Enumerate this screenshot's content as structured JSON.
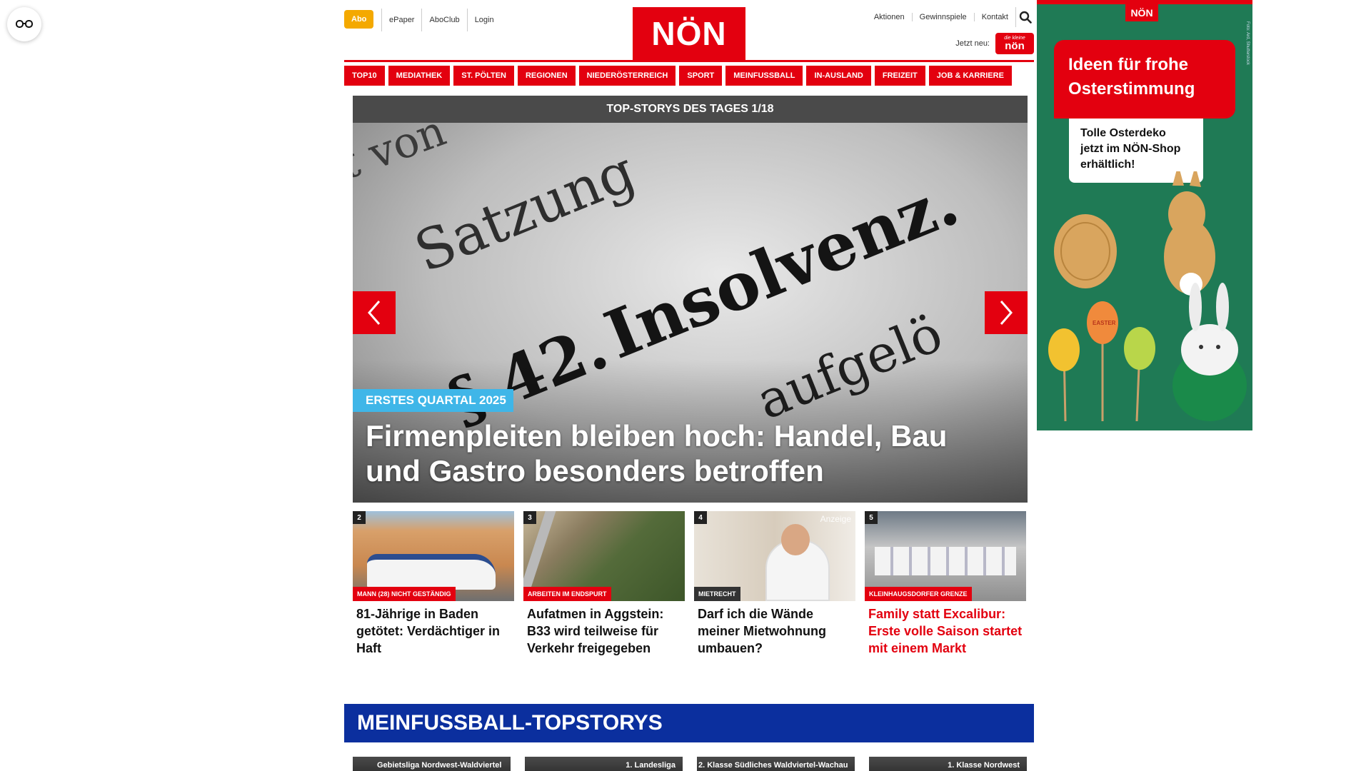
{
  "header": {
    "abo_label": "Abo",
    "left_links": [
      "ePaper",
      "AboClub",
      "Login"
    ],
    "logo_text": "NÖN",
    "right_links": [
      "Aktionen",
      "Gewinnspiele",
      "Kontakt"
    ],
    "jetzt_neu_label": "Jetzt neu:",
    "badge_small": "die kleine",
    "badge_text": "nön"
  },
  "nav": {
    "items": [
      "TOP10",
      "MEDIATHEK",
      "ST. PÖLTEN",
      "REGIONEN",
      "NIEDERÖSTERREICH",
      "SPORT",
      "MEINFUSSBALL",
      "IN-AUSLAND",
      "FREIZEIT",
      "JOB & KARRIERE"
    ]
  },
  "hero": {
    "header": "TOP-STORYS DES TAGES 1/18",
    "tag": "ERSTES QUARTAL 2025",
    "title": "Firmenpleiten bleiben hoch: Handel, Bau und Gastro besonders betroffen",
    "image_words": [
      "Insolvenz.",
      "Satzung",
      "aufgelö",
      "§ 42.",
      "t von"
    ]
  },
  "cards": [
    {
      "num": "2",
      "category": "MANN (28) NICHT GESTÄNDIG",
      "title": "81-Jährige in Baden getötet: Verdächtiger in Haft",
      "cat_color": "#e3000f",
      "title_color": "#111111"
    },
    {
      "num": "3",
      "category": "ARBEITEN IM ENDSPURT",
      "title": "Aufatmen in Aggstein: B33 wird teilweise für Verkehr freigegeben",
      "cat_color": "#e3000f",
      "title_color": "#111111"
    },
    {
      "num": "4",
      "category": "MIETRECHT",
      "title": "Darf ich die Wände meiner Mietwohnung umbauen?",
      "cat_color": "#333333",
      "title_color": "#111111",
      "ad_label": "Anzeige"
    },
    {
      "num": "5",
      "category": "KLEINHAUGSDORFER GRENZE",
      "title": "Family statt Excalibur: Erste volle Saison startet mit einem Markt",
      "cat_color": "#e3000f",
      "title_color": "#e3000f"
    }
  ],
  "section": {
    "title": "MEINFUSSBALL-TOPSTORYS",
    "strip_labels": [
      "Gebietsliga Nordwest-Waldviertel",
      "1. Landesliga",
      "2. Klasse Südliches Waldviertel-Wachau",
      "1. Klasse Nordwest"
    ]
  },
  "ad": {
    "logo": "NÖN",
    "headline": "Ideen für frohe Osterstimmung",
    "note": "Tolle Osterdeko jetzt im NÖN-Shop erhältlich!",
    "egg_label": "EASTER",
    "credit": "Foto: Ard, Shutterstock"
  },
  "colors": {
    "brand_red": "#e3000f",
    "abo_orange": "#f4a900",
    "section_blue": "#0b2f9e",
    "tag_blue": "#3fb6e8",
    "ad_green": "#1f7a55"
  }
}
